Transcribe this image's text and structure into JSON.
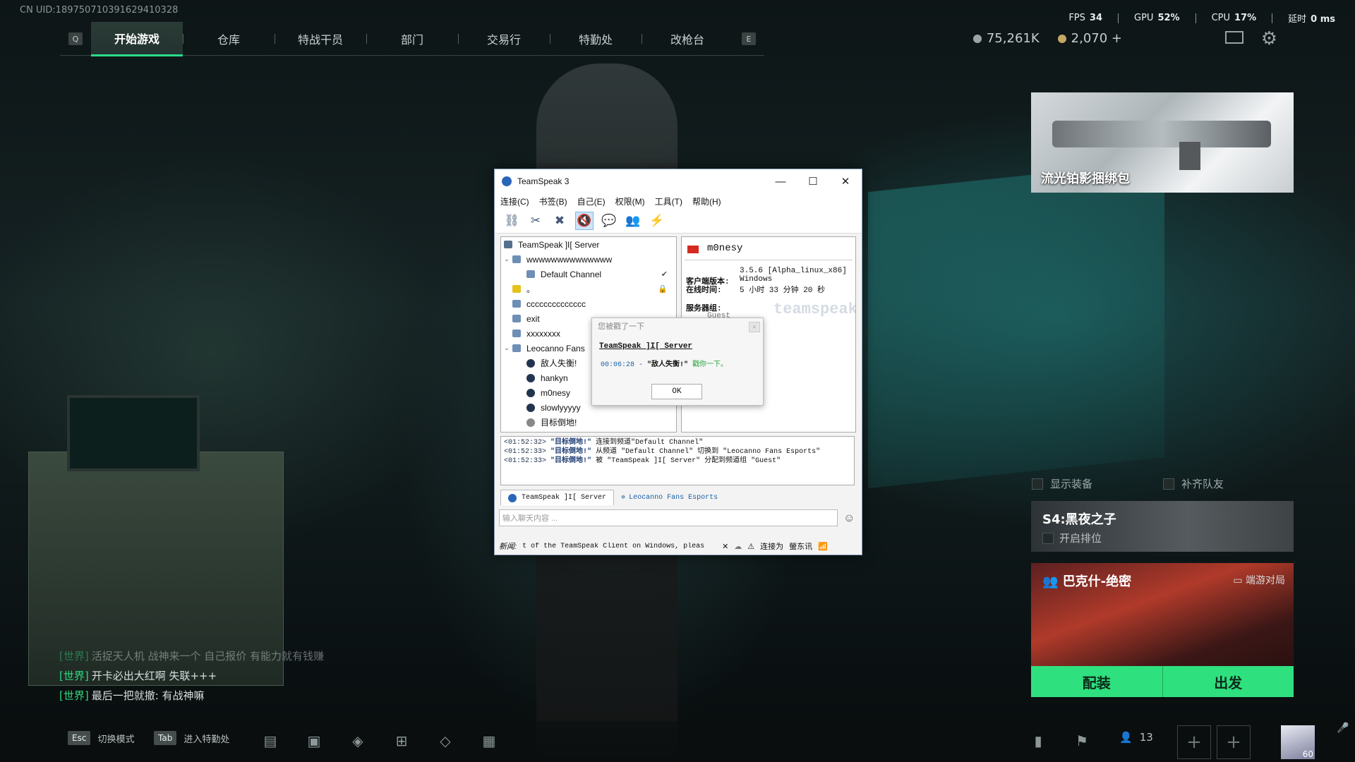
{
  "uid": "CN UID:18975071039162941032​8",
  "nav": {
    "left_key": "Q",
    "right_key": "E",
    "tabs": [
      "开始游戏",
      "仓库",
      "特战干员",
      "部门",
      "交易行",
      "特勤处",
      "改枪台"
    ]
  },
  "stats": {
    "fps_label": "FPS",
    "fps": "34",
    "gpu_label": "GPU",
    "gpu": "52%",
    "cpu_label": "CPU",
    "cpu": "17%",
    "latency_label": "延时",
    "latency": "0 ms"
  },
  "currency": {
    "silver": "75,261K",
    "gold": "2,070 +"
  },
  "promo": {
    "title": "流光铂影捆绑包"
  },
  "toggles": {
    "show_gear": "显示装备",
    "fill_team": "补齐队友"
  },
  "season": {
    "title": "S4:黑夜之子",
    "rank_label": "开启排位"
  },
  "map": {
    "title": "巴克什-绝密",
    "mode": "端游对局"
  },
  "actions": {
    "loadout": "配装",
    "deploy": "出发"
  },
  "chat": [
    {
      "channel": "[世界]",
      "text": "活捉天人机 战神来一个 自己报价 有能力就有钱赚"
    },
    {
      "channel": "[世界]",
      "text": "开卡必出大红啊 失联+++"
    },
    {
      "channel": "[世界]",
      "text": "最后一把就撤: 有战神嘛"
    }
  ],
  "bottom": {
    "esc_key": "Esc",
    "esc_label": "切换模式",
    "tab_key": "Tab",
    "tab_label": "进入特勤处",
    "friends": "13",
    "avatar_level": "60"
  },
  "ts": {
    "title": "TeamSpeak 3",
    "menu": [
      "连接(C)",
      "书签(B)",
      "自己(E)",
      "权限(M)",
      "工具(T)",
      "帮助(H)"
    ],
    "tree": [
      {
        "type": "server",
        "label": "TeamSpeak ]I[ Server"
      },
      {
        "type": "channel",
        "label": "wwwwwwwwwwwwww",
        "arrow": "v"
      },
      {
        "type": "subchannel",
        "label": "Default Channel",
        "right": "✔"
      },
      {
        "type": "channel-y",
        "label": "。",
        "right": "🔒"
      },
      {
        "type": "channel",
        "label": "cccccccccccccc"
      },
      {
        "type": "channel",
        "label": "exit"
      },
      {
        "type": "channel",
        "label": "xxxxxxxx"
      },
      {
        "type": "channel",
        "label": "Leocanno Fans",
        "arrow": "v"
      },
      {
        "type": "user",
        "label": "敌人失衡!"
      },
      {
        "type": "user",
        "label": "hankyn"
      },
      {
        "type": "user",
        "label": "m0nesy"
      },
      {
        "type": "user",
        "label": "slowlyyyyy"
      },
      {
        "type": "user-me",
        "label": "目标倒地!"
      }
    ],
    "info": {
      "name": "m0nesy",
      "version_label": "客户端版本:",
      "version": "3.5.6 [Alpha_linux_x86]",
      "os": "Windows",
      "online_label": "在线时间:",
      "online": "5 小时 33 分钟 20 秒",
      "group_label": "服务器组:",
      "group": "Guest",
      "watermark": "teamspeak"
    },
    "log": [
      {
        "time": "<01:52:32>",
        "who": "\"目标倒地!\"",
        "text": "连接到频道\"Default Channel\""
      },
      {
        "time": "<01:52:33>",
        "who": "\"目标倒地!\"",
        "text": "从频道 \"Default Channel\" 切换到 \"Leocanno Fans Esports\""
      },
      {
        "time": "<01:52:33>",
        "who": "\"目标倒地!\"",
        "text": "被 \"TeamSpeak ]I[ Server\" 分配到频道组 \"Guest\""
      }
    ],
    "tabs": [
      "TeamSpeak ]I[ Server",
      "Leocanno Fans Esports"
    ],
    "input_placeholder": "输入聊天内容 ...",
    "news_label": "新闻:",
    "news": "t of the TeamSpeak Client on Windows, pleas",
    "connected_label": "连接为",
    "connected_name": "螢东讯"
  },
  "poke": {
    "title": "您被戳了一下",
    "server": "TeamSpeak ]I[ Server",
    "time": "00:06:28 -",
    "who": "\"敌人失衡!\"",
    "text": "戳你一下。",
    "ok": "OK"
  },
  "colors": {
    "accent_green": "#2fe07e",
    "map_red": "#b03a2a"
  }
}
